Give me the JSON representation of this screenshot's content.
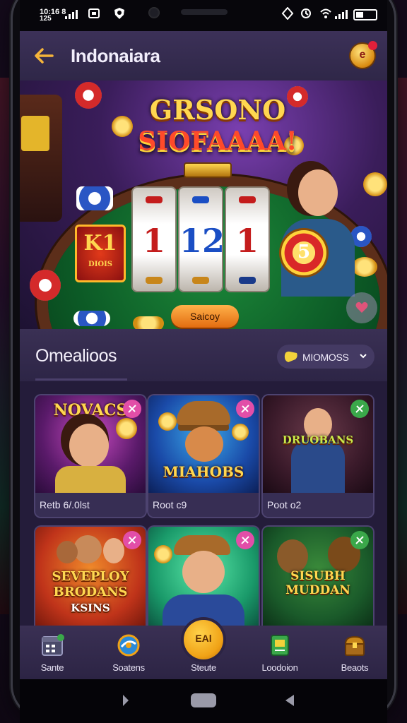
{
  "status_bar": {
    "line1": "10:16 8",
    "line2": "125"
  },
  "header": {
    "title": "Indonaiara",
    "back_icon": "back-arrow-icon",
    "coin_label": "e"
  },
  "banner": {
    "title_line1": "GRSONO",
    "title_line2": "SIOFAAAA!",
    "reels": [
      "1",
      "12",
      "1"
    ],
    "side_badge_big": "K1",
    "side_badge_small": "DIOIS",
    "chip_label": "5",
    "button_label": "Saicoy"
  },
  "section": {
    "title": "Omealioos",
    "filter_label": "MIOMOSS"
  },
  "games": [
    {
      "art_title": "NOVACS",
      "label": "Retb 6/.0lst",
      "theme": "#7a1d8a",
      "fav_color": "#e24ea8"
    },
    {
      "art_title": "MIAHOBS",
      "label": "Root c9",
      "theme": "#1a4aa8",
      "fav_color": "#e24ea8"
    },
    {
      "art_title": "DRUOBANS",
      "label": "Poot o2",
      "theme": "#3a1a2a",
      "fav_color": "#3aa84a"
    },
    {
      "art_title": "SEVEPLOY BRODANS",
      "art_sub": "KSINS",
      "label": "",
      "theme": "#c0341a",
      "fav_color": "#e24ea8"
    },
    {
      "art_title": "",
      "label": "",
      "theme": "#1a9a6a",
      "fav_color": "#e24ea8"
    },
    {
      "art_title": "SISUBH MUDDAN",
      "label": "",
      "theme": "#1a5a2a",
      "fav_color": "#3aa84a"
    }
  ],
  "bottom_nav": [
    {
      "label": "Sante",
      "icon": "calendar-icon"
    },
    {
      "label": "Soatens",
      "icon": "spin-wheel-icon"
    },
    {
      "label": "Steute",
      "icon": "center-bubble-icon",
      "bubble_text": "EAl"
    },
    {
      "label": "Loodoion",
      "icon": "book-icon"
    },
    {
      "label": "Beaots",
      "icon": "treasure-chest-icon"
    }
  ],
  "colors": {
    "accent": "#f0a216",
    "background": "#2a2143",
    "topbar": "#3c3158"
  }
}
